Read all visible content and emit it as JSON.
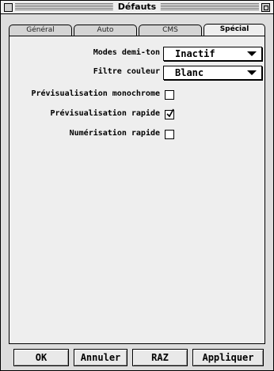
{
  "window": {
    "title": "Défauts"
  },
  "tabs": [
    {
      "label": "Général",
      "active": false
    },
    {
      "label": "Auto",
      "active": false
    },
    {
      "label": "CMS",
      "active": false
    },
    {
      "label": "Spécial",
      "active": true
    }
  ],
  "settings": {
    "halftone": {
      "label": "Modes demi-ton",
      "value": "Inactif"
    },
    "color_filter": {
      "label": "Filtre couleur",
      "value": "Blanc"
    },
    "mono_preview": {
      "label": "Prévisualisation monochrome",
      "checked": false
    },
    "fast_preview": {
      "label": "Prévisualisation rapide",
      "checked": true
    },
    "fast_scan": {
      "label": "Numérisation rapide",
      "checked": false
    }
  },
  "buttons": {
    "ok": "OK",
    "cancel": "Annuler",
    "reset": "RAZ",
    "apply": "Appliquer"
  }
}
